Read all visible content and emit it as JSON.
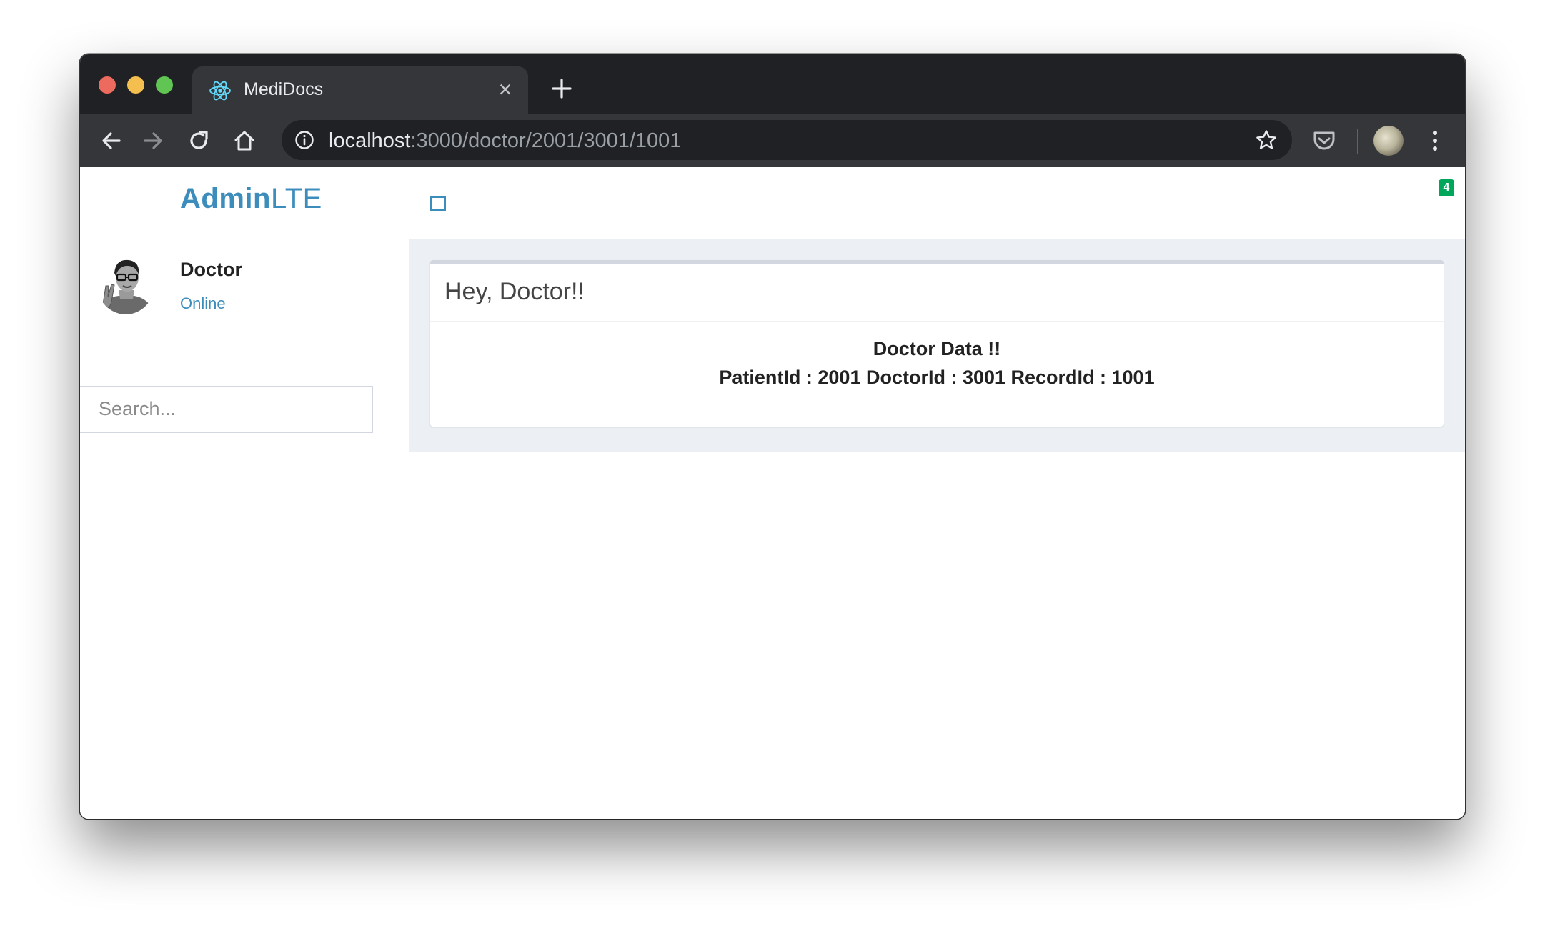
{
  "browser": {
    "tab": {
      "title": "MediDocs",
      "favicon": "react-logo-icon"
    },
    "url": {
      "host": "localhost",
      "path": ":3000/doctor/2001/3001/1001"
    }
  },
  "app": {
    "logo": {
      "strong": "Admin",
      "light": "LTE"
    },
    "user": {
      "name": "Doctor",
      "status": "Online"
    },
    "search": {
      "placeholder": "Search...",
      "value": ""
    },
    "notification_badge": "4",
    "box": {
      "title": "Hey, Doctor!!",
      "body_heading": "Doctor Data !!",
      "body_line": "PatientId : 2001 DoctorId : 3001 RecordId : 1001"
    }
  },
  "colors": {
    "brand": "#3c8dbc",
    "badge": "#00a65a",
    "content_bg": "#ecf0f5",
    "chrome_dark": "#202124",
    "chrome_toolbar": "#35363a"
  }
}
